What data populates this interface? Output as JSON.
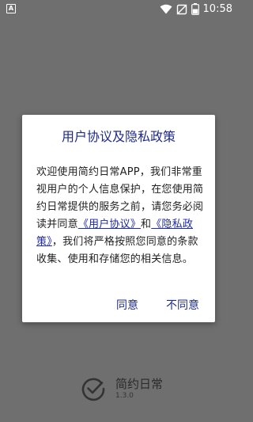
{
  "status_bar": {
    "left_icon": "A",
    "battery": "52",
    "time": "10:58"
  },
  "dialog": {
    "title": "用户协议及隐私政策",
    "body_part1": "欢迎使用简约日常APP，我们非常重视用户的个人信息保护，在您使用简约日常提供的服务之前，请您务必阅读并同意",
    "link_user_agreement": "《用户协议》",
    "body_and": "和",
    "link_privacy_policy": "《隐私政策》",
    "body_part2": "，我们将严格按照您同意的条款收集、使用和存储您的相关信息。",
    "agree_label": "同意",
    "disagree_label": "不同意"
  },
  "app": {
    "name": "简约日常",
    "version": "1.3.0"
  },
  "colors": {
    "overlay_background": "#6f6f6f",
    "accent": "#1f2a8a",
    "link": "#1f2aa8"
  },
  "icons": [
    "wifi-icon",
    "silent-icon",
    "battery-icon",
    "check-circle-icon"
  ]
}
